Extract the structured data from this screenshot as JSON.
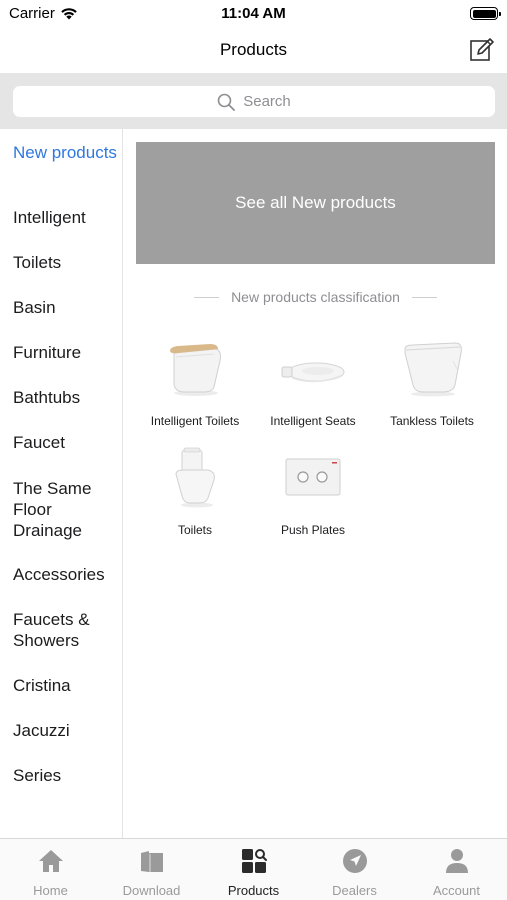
{
  "status": {
    "carrier": "Carrier",
    "time": "11:04 AM"
  },
  "nav": {
    "title": "Products"
  },
  "search": {
    "placeholder": "Search"
  },
  "sidebar": {
    "items": [
      {
        "label": "New products",
        "active": true
      },
      {
        "label": "Intelligent"
      },
      {
        "label": "Toilets"
      },
      {
        "label": "Basin"
      },
      {
        "label": "Furniture"
      },
      {
        "label": "Bathtubs"
      },
      {
        "label": "Faucet"
      },
      {
        "label": "The Same Floor Drainage"
      },
      {
        "label": "Accessories"
      },
      {
        "label": "Faucets & Showers"
      },
      {
        "label": "Cristina"
      },
      {
        "label": "Jacuzzi"
      },
      {
        "label": "Series"
      }
    ]
  },
  "content": {
    "banner": "See all New products",
    "section_title": "New products classification",
    "products": [
      {
        "label": "Intelligent Toilets",
        "icon": "smart-toilet-icon"
      },
      {
        "label": "Intelligent Seats",
        "icon": "toilet-seat-icon"
      },
      {
        "label": "Tankless Toilets",
        "icon": "tankless-toilet-icon"
      },
      {
        "label": "Toilets",
        "icon": "toilet-icon"
      },
      {
        "label": "Push Plates",
        "icon": "push-plate-icon"
      }
    ]
  },
  "tabs": [
    {
      "label": "Home",
      "icon": "home-icon"
    },
    {
      "label": "Download",
      "icon": "download-icon"
    },
    {
      "label": "Products",
      "icon": "products-icon",
      "active": true
    },
    {
      "label": "Dealers",
      "icon": "location-arrow-icon"
    },
    {
      "label": "Account",
      "icon": "person-icon"
    }
  ],
  "colors": {
    "accent": "#2f78e0",
    "banner": "#9f9f9f",
    "search_bg": "#e5e5e5"
  }
}
